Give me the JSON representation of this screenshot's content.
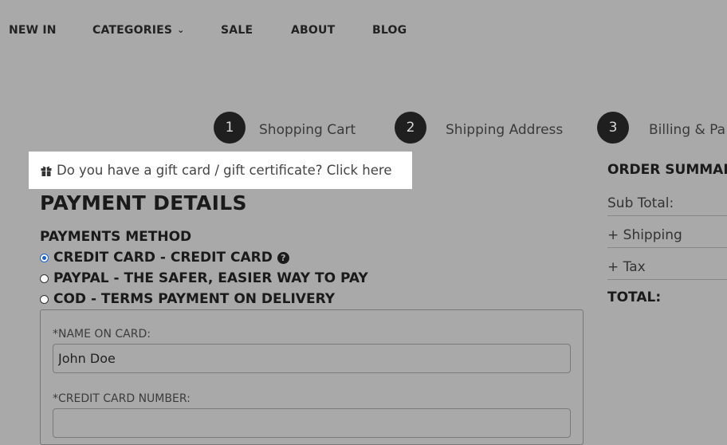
{
  "nav": {
    "items": [
      {
        "label": "NEW IN"
      },
      {
        "label": "CATEGORIES",
        "icon": "chevron-down-icon"
      },
      {
        "label": "SALE"
      },
      {
        "label": "ABOUT"
      },
      {
        "label": "BLOG"
      }
    ]
  },
  "steps": [
    {
      "number": "1",
      "label": "Shopping Cart"
    },
    {
      "number": "2",
      "label": "Shipping Address"
    },
    {
      "number": "3",
      "label": "Billing & Pa"
    }
  ],
  "gift": {
    "icon": "gift-icon",
    "text": "Do you have a gift card / gift certificate? Click here"
  },
  "payment": {
    "title": "PAYMENT DETAILS",
    "method_title": "PAYMENTS METHOD",
    "options": [
      {
        "label": "CREDIT CARD - CREDIT CARD",
        "selected": true,
        "help_icon": "question-circle-icon"
      },
      {
        "label": "PAYPAL - THE SAFER, EASIER WAY TO PAY",
        "selected": false
      },
      {
        "label": "COD - TERMS PAYMENT ON DELIVERY",
        "selected": false
      }
    ],
    "card": {
      "name_label": "*NAME ON CARD:",
      "name_value": "John Doe",
      "number_label": "*CREDIT CARD NUMBER:",
      "number_value": ""
    }
  },
  "summary": {
    "title": "ORDER SUMMAR",
    "rows": [
      {
        "label": "Sub Total:"
      },
      {
        "label": "+ Shipping"
      },
      {
        "label": "+ Tax"
      }
    ],
    "total_label": "TOTAL:"
  },
  "colors": {
    "background": "#a9a9a9",
    "step_circle": "#1f1f1f",
    "radio_selected": "#1a5fd0",
    "gift_box": "#ffffff"
  }
}
